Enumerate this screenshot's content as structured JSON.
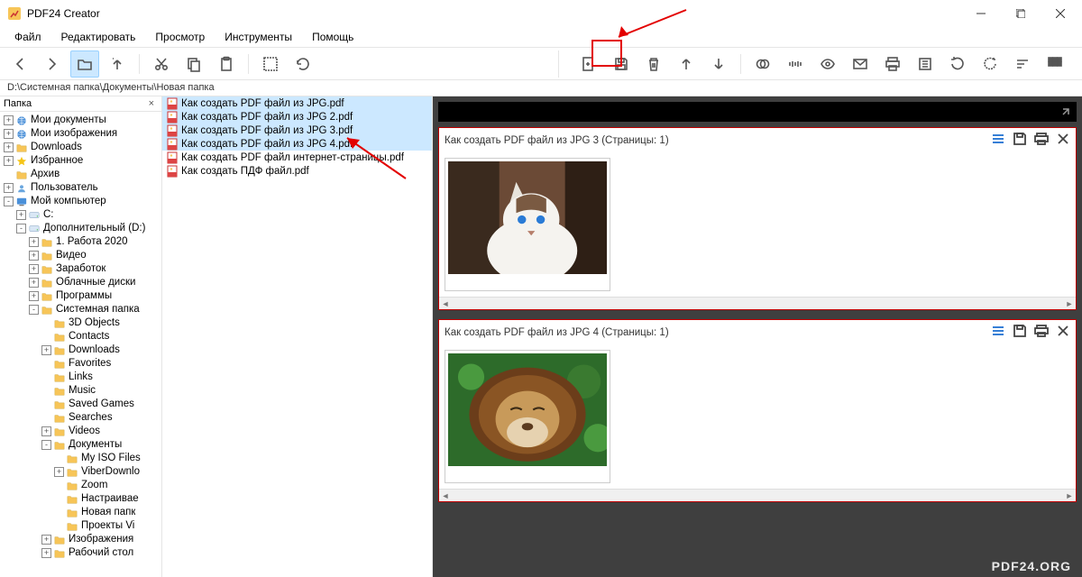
{
  "window": {
    "title": "PDF24 Creator"
  },
  "menu": {
    "items": [
      "Файл",
      "Редактировать",
      "Просмотр",
      "Инструменты",
      "Помощь"
    ]
  },
  "path": "D:\\Системная папка\\Документы\\Новая папка",
  "sidebar": {
    "header": "Папка"
  },
  "tree": [
    {
      "depth": 0,
      "exp": "+",
      "icon": "globe",
      "label": "Мои документы"
    },
    {
      "depth": 0,
      "exp": "+",
      "icon": "globe",
      "label": "Мои изображения"
    },
    {
      "depth": 0,
      "exp": "+",
      "icon": "folder",
      "label": "Downloads"
    },
    {
      "depth": 0,
      "exp": "+",
      "icon": "star",
      "label": "Избранное"
    },
    {
      "depth": 0,
      "exp": "",
      "icon": "folder",
      "label": "Архив"
    },
    {
      "depth": 0,
      "exp": "+",
      "icon": "user",
      "label": "Пользователь"
    },
    {
      "depth": 0,
      "exp": "-",
      "icon": "pc",
      "label": "Мой компьютер"
    },
    {
      "depth": 1,
      "exp": "+",
      "icon": "drive",
      "label": "C:"
    },
    {
      "depth": 1,
      "exp": "-",
      "icon": "drive",
      "label": "Дополнительный (D:)"
    },
    {
      "depth": 2,
      "exp": "+",
      "icon": "folder",
      "label": "1. Работа 2020"
    },
    {
      "depth": 2,
      "exp": "+",
      "icon": "folder",
      "label": "Видео"
    },
    {
      "depth": 2,
      "exp": "+",
      "icon": "folder",
      "label": "Заработок"
    },
    {
      "depth": 2,
      "exp": "+",
      "icon": "folder",
      "label": "Облачные диски"
    },
    {
      "depth": 2,
      "exp": "+",
      "icon": "folder",
      "label": "Программы"
    },
    {
      "depth": 2,
      "exp": "-",
      "icon": "folder",
      "label": "Системная папка"
    },
    {
      "depth": 3,
      "exp": "",
      "icon": "folder",
      "label": "3D Objects"
    },
    {
      "depth": 3,
      "exp": "",
      "icon": "folder",
      "label": "Contacts"
    },
    {
      "depth": 3,
      "exp": "+",
      "icon": "folder",
      "label": "Downloads"
    },
    {
      "depth": 3,
      "exp": "",
      "icon": "folder",
      "label": "Favorites"
    },
    {
      "depth": 3,
      "exp": "",
      "icon": "folder",
      "label": "Links"
    },
    {
      "depth": 3,
      "exp": "",
      "icon": "folder",
      "label": "Music"
    },
    {
      "depth": 3,
      "exp": "",
      "icon": "folder",
      "label": "Saved Games"
    },
    {
      "depth": 3,
      "exp": "",
      "icon": "folder",
      "label": "Searches"
    },
    {
      "depth": 3,
      "exp": "+",
      "icon": "folder",
      "label": "Videos"
    },
    {
      "depth": 3,
      "exp": "-",
      "icon": "folder",
      "label": "Документы"
    },
    {
      "depth": 4,
      "exp": "",
      "icon": "folder",
      "label": "My ISO Files"
    },
    {
      "depth": 4,
      "exp": "+",
      "icon": "folder",
      "label": "ViberDownlo"
    },
    {
      "depth": 4,
      "exp": "",
      "icon": "folder",
      "label": "Zoom"
    },
    {
      "depth": 4,
      "exp": "",
      "icon": "folder",
      "label": "Настраивае"
    },
    {
      "depth": 4,
      "exp": "",
      "icon": "folder",
      "label": "Новая папк"
    },
    {
      "depth": 4,
      "exp": "",
      "icon": "folder",
      "label": "Проекты Vi"
    },
    {
      "depth": 3,
      "exp": "+",
      "icon": "folder",
      "label": "Изображения"
    },
    {
      "depth": 3,
      "exp": "+",
      "icon": "folder",
      "label": "Рабочий стол"
    }
  ],
  "files": [
    {
      "name": "Как создать PDF файл из JPG.pdf",
      "sel": true
    },
    {
      "name": "Как создать PDF файл из JPG 2.pdf",
      "sel": true
    },
    {
      "name": "Как создать PDF файл из JPG 3.pdf",
      "sel": true
    },
    {
      "name": "Как создать PDF файл из JPG 4.pdf",
      "sel": true
    },
    {
      "name": "Как создать PDF файл интернет-страницы.pdf",
      "sel": false
    },
    {
      "name": "Как создать ПДФ файл.pdf",
      "sel": false
    }
  ],
  "cards": [
    {
      "title": "Как создать PDF файл из JPG 3 (Страницы: 1)",
      "img": "cat"
    },
    {
      "title": "Как создать PDF файл из JPG 4 (Страницы: 1)",
      "img": "lion"
    }
  ],
  "watermark": "PDF24.ORG"
}
